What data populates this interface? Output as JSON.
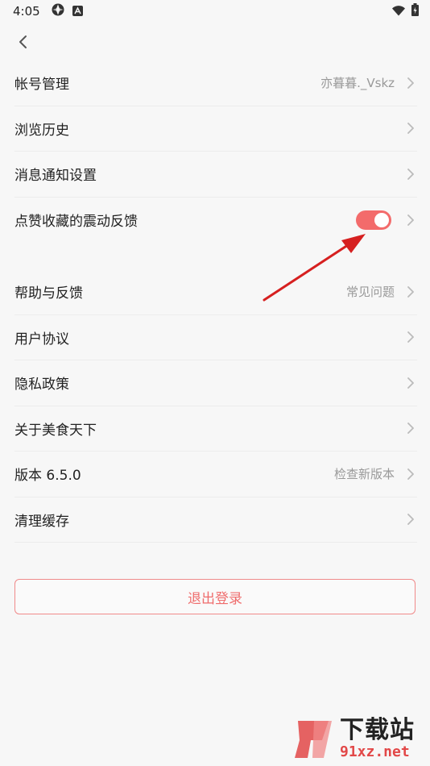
{
  "status_bar": {
    "time": "4:05"
  },
  "settings_group_1": [
    {
      "label": "帐号管理",
      "value": "亦暮暮._Vskz"
    },
    {
      "label": "浏览历史",
      "value": ""
    },
    {
      "label": "消息通知设置",
      "value": ""
    },
    {
      "label": "点赞收藏的震动反馈",
      "value": "",
      "toggle_on": true
    }
  ],
  "settings_group_2": [
    {
      "label": "帮助与反馈",
      "value": "常见问题"
    },
    {
      "label": "用户协议",
      "value": ""
    },
    {
      "label": "隐私政策",
      "value": ""
    },
    {
      "label": "关于美食天下",
      "value": ""
    },
    {
      "label": "版本 6.5.0",
      "value": "检查新版本"
    },
    {
      "label": "清理缓存",
      "value": ""
    }
  ],
  "logout": {
    "label": "退出登录"
  },
  "watermark": {
    "title": "下载站",
    "subtitle": "91xz.net"
  },
  "colors": {
    "accent": "#f36b6b",
    "annotation_arrow": "#d62020"
  }
}
